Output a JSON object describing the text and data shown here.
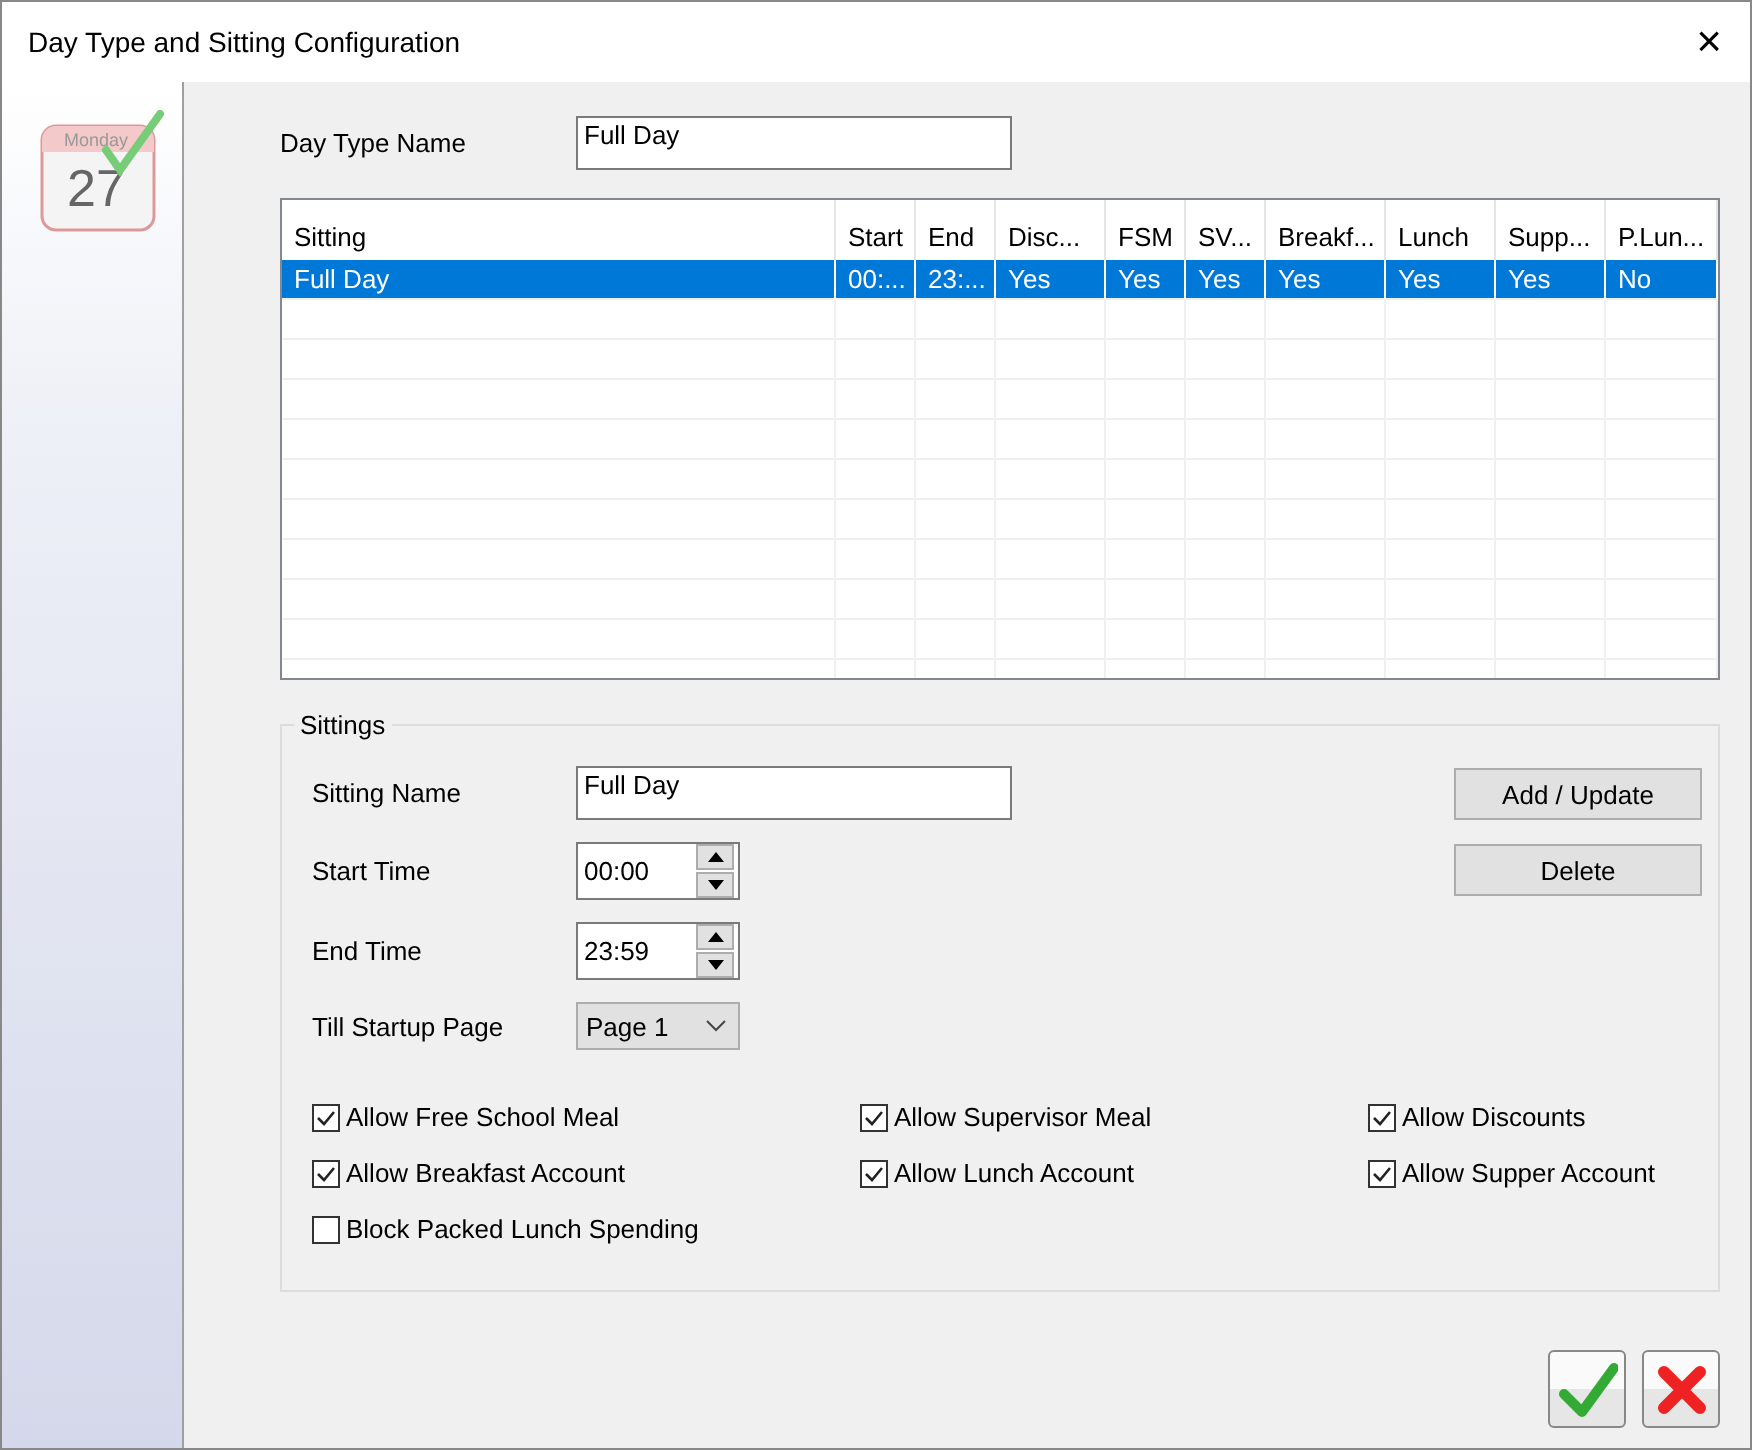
{
  "window": {
    "title": "Day Type and Sitting Configuration",
    "close": "×"
  },
  "calendar_icon": {
    "day": "Monday",
    "date": "27"
  },
  "day_type_name": {
    "label": "Day Type Name",
    "value": "Full Day"
  },
  "table": {
    "columns": [
      "Sitting",
      "Start",
      "End",
      "Disc...",
      "FSM",
      "SV...",
      "Breakf...",
      "Lunch",
      "Supp...",
      "P.Lun..."
    ],
    "rows": [
      {
        "selected": true,
        "cells": [
          "Full Day",
          "00:...",
          "23:...",
          "Yes",
          "Yes",
          "Yes",
          "Yes",
          "Yes",
          "Yes",
          "No"
        ]
      }
    ]
  },
  "sittings": {
    "title": "Sittings",
    "sitting_name": {
      "label": "Sitting Name",
      "value": "Full Day"
    },
    "start_time": {
      "label": "Start Time",
      "value": "00:00"
    },
    "end_time": {
      "label": "End Time",
      "value": "23:59"
    },
    "till_startup_page": {
      "label": "Till Startup Page",
      "value": "Page 1"
    },
    "buttons": [
      "Add / Update",
      "Delete"
    ],
    "checkboxes": [
      {
        "label": "Allow Free School Meal",
        "checked": true
      },
      {
        "label": "Allow Supervisor Meal",
        "checked": true
      },
      {
        "label": "Allow Discounts",
        "checked": true
      },
      {
        "label": "Allow Breakfast Account",
        "checked": true
      },
      {
        "label": "Allow Lunch Account",
        "checked": true
      },
      {
        "label": "Allow Supper Account",
        "checked": true
      },
      {
        "label": "Block Packed Lunch Spending",
        "checked": false
      }
    ]
  }
}
